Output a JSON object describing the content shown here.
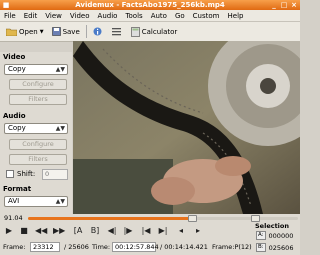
{
  "window": {
    "title": "Avidemux - FactsAbo1975_256kb.mp4"
  },
  "menu": [
    "File",
    "Edit",
    "View",
    "Video",
    "Audio",
    "Tools",
    "Auto",
    "Go",
    "Custom",
    "Help"
  ],
  "toolbar": {
    "open": "Open",
    "save": "Save",
    "calculator": "Calculator"
  },
  "video_section": {
    "label": "Video",
    "codec": "Copy",
    "configure": "Configure",
    "filters": "Filters"
  },
  "audio_section": {
    "label": "Audio",
    "codec": "Copy",
    "configure": "Configure",
    "filters": "Filters",
    "shift_label": "Shift:",
    "shift_value": "0"
  },
  "format_section": {
    "label": "Format",
    "container": "AVI"
  },
  "seek": {
    "position_label": "91.04",
    "progress": 0.606,
    "marker_b": 0.84
  },
  "selection": {
    "label": "Selection",
    "a_label": "A:",
    "a_value": "000000",
    "b_label": "B:",
    "b_value": "025606"
  },
  "status": {
    "frame_label": "Frame:",
    "frame_value": "23312",
    "frame_total": "/ 25606",
    "time_label": "Time:",
    "time_value": "00:12:57.844",
    "duration": "/ 00:14:14.421",
    "frame_type": "Frame:P(12)"
  },
  "colors": {
    "accent": "#e8741d",
    "title_bar": "#e06a12"
  }
}
